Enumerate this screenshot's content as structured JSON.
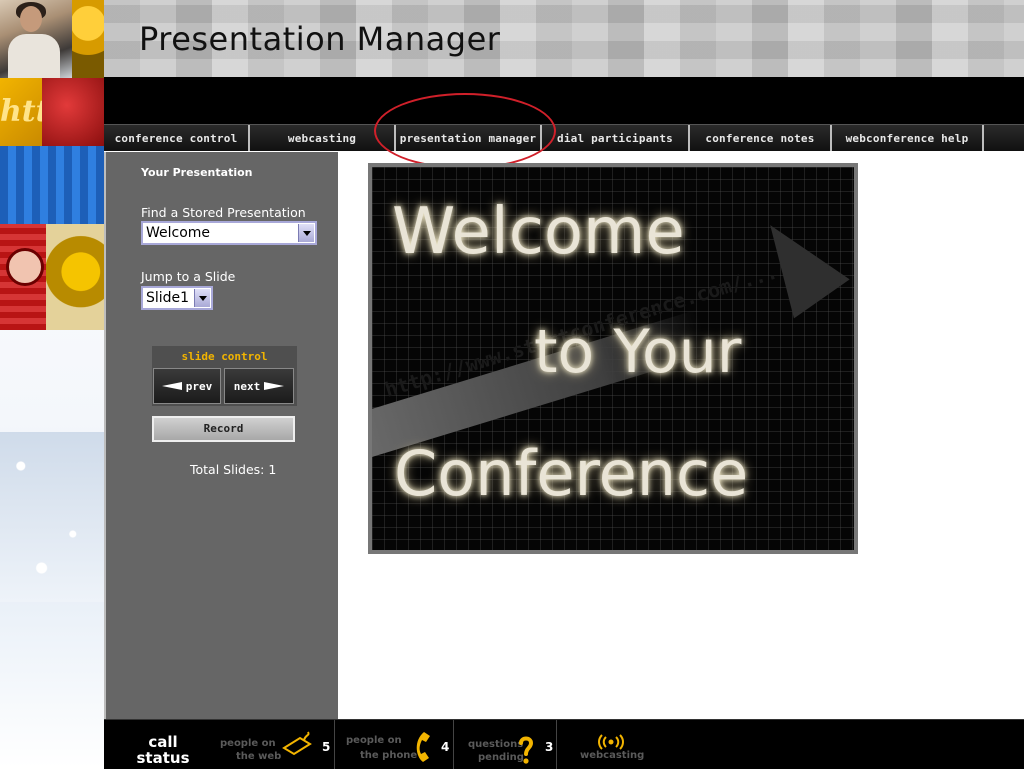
{
  "header": {
    "title": "Presentation Manager"
  },
  "nav": [
    {
      "label": "conference control",
      "active": false
    },
    {
      "label": "webcasting",
      "active": false
    },
    {
      "label": "presentation manager",
      "active": true
    },
    {
      "label": "dial participants",
      "active": false
    },
    {
      "label": "conference notes",
      "active": false
    },
    {
      "label": "webconference help",
      "active": false
    }
  ],
  "panel": {
    "heading": "Your Presentation",
    "find_label": "Find a Stored Presentation",
    "find_value": "Welcome",
    "jump_label": "Jump to a Slide",
    "jump_value": "Slide1",
    "slide_control_label": "slide control",
    "prev_label": "prev",
    "next_label": "next",
    "record_label": "Record",
    "total_slides": "Total Slides: 1"
  },
  "slide": {
    "line1": "Welcome",
    "line2": "to Your",
    "line3": "Conference",
    "url_text": "http://www.startconference.com/..."
  },
  "status": {
    "title_line1": "call",
    "title_line2": "status",
    "web_label_1": "people on",
    "web_label_2": "the web",
    "web_count": "5",
    "phone_label_1": "people on",
    "phone_label_2": "the phone",
    "phone_count": "4",
    "questions_label_1": "questions",
    "questions_label_2": "pending",
    "questions_count": "3",
    "webcasting_label": "webcasting"
  },
  "colors": {
    "accent_red": "#d0202a",
    "slide_control_gold": "#f2b400",
    "panel_gray": "#666666"
  },
  "icons": [
    "mouse-icon",
    "phone-icon",
    "question-mark-icon",
    "broadcast-icon",
    "cursor-arrow-icon"
  ]
}
